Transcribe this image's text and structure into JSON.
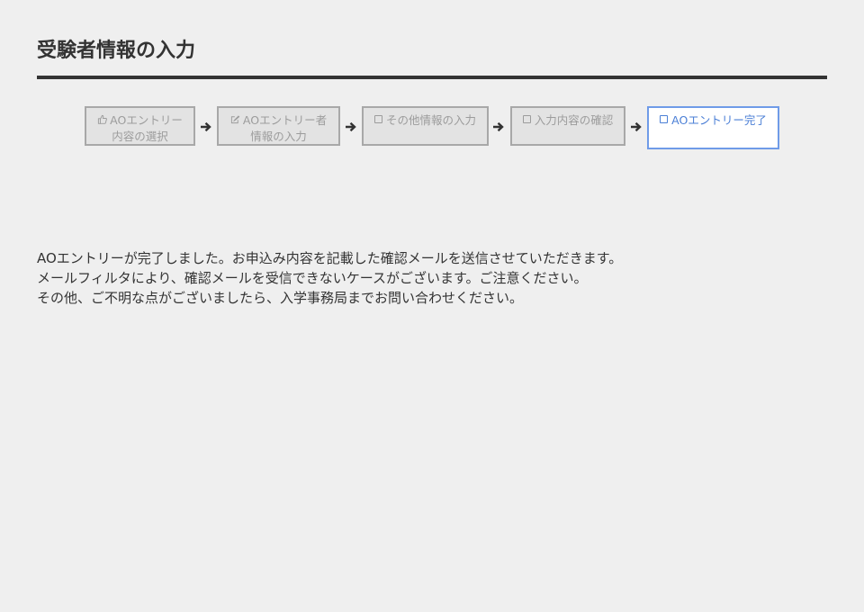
{
  "header": {
    "title": "受験者情報の入力"
  },
  "steps": [
    {
      "icon": "thumbs-up-icon",
      "line1": "AOエントリー",
      "line2": "内容の選択",
      "state": "done"
    },
    {
      "icon": "edit-icon",
      "line1": "AOエントリー者",
      "line2": "情報の入力",
      "state": "done"
    },
    {
      "icon": "checkbox-icon",
      "line1": "その他情報の入力",
      "line2": "",
      "state": "done"
    },
    {
      "icon": "checkbox-icon",
      "line1": "入力内容の確認",
      "line2": "",
      "state": "done"
    },
    {
      "icon": "checkbox-icon",
      "line1": "AOエントリー完了",
      "line2": "",
      "state": "current"
    }
  ],
  "message": {
    "lines": [
      "AOエントリーが完了しました。お申込み内容を記載した確認メールを送信させていただきます。",
      "メールフィルタにより、確認メールを受信できないケースがございます。ご注意ください。",
      "その他、ご不明な点がございましたら、入学事務局までお問い合わせください。"
    ]
  },
  "colors": {
    "background": "#efefef",
    "text": "#333333",
    "step_inactive_border": "#a8a8a8",
    "step_inactive_text": "#9c9c9c",
    "step_active_border": "#6f9be8",
    "step_active_text": "#4b7fd6"
  }
}
